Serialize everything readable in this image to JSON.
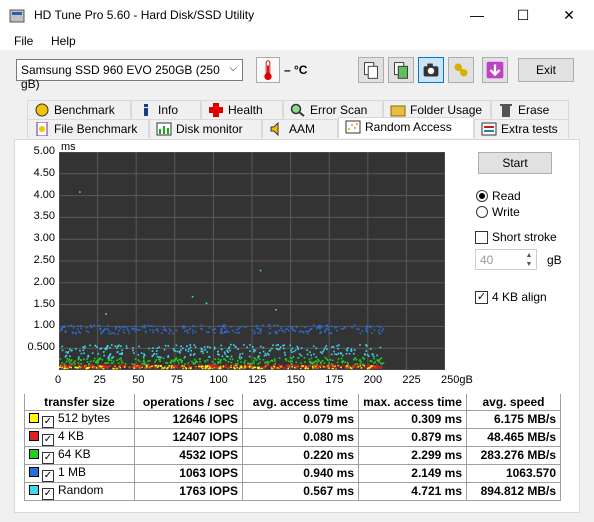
{
  "window": {
    "title": "HD Tune Pro 5.60 - Hard Disk/SSD Utility",
    "minimize": "—",
    "maximize": "☐",
    "close": "✕"
  },
  "menu": {
    "file": "File",
    "help": "Help"
  },
  "toolbar": {
    "drive": "Samsung SSD 960 EVO 250GB (250 gB)",
    "temperature": "– °C",
    "exit_label": "Exit"
  },
  "tabs": {
    "row1": [
      {
        "label": "Benchmark",
        "icon": "benchmark-icon"
      },
      {
        "label": "Info",
        "icon": "info-icon"
      },
      {
        "label": "Health",
        "icon": "health-icon"
      },
      {
        "label": "Error Scan",
        "icon": "error-scan-icon"
      },
      {
        "label": "Folder Usage",
        "icon": "folder-icon"
      },
      {
        "label": "Erase",
        "icon": "trash-icon"
      }
    ],
    "row2": [
      {
        "label": "File Benchmark",
        "icon": "file-benchmark-icon"
      },
      {
        "label": "Disk monitor",
        "icon": "disk-monitor-icon"
      },
      {
        "label": "AAM",
        "icon": "speaker-icon"
      },
      {
        "label": "Random Access",
        "icon": "random-access-icon"
      },
      {
        "label": "Extra tests",
        "icon": "extra-tests-icon"
      }
    ]
  },
  "controls": {
    "start": "Start",
    "read": "Read",
    "write": "Write",
    "short_stroke": "Short stroke",
    "stroke_value": "40",
    "stroke_unit": "gB",
    "align": "4 KB align",
    "mode_selected": "Read"
  },
  "chart_data": {
    "type": "scatter",
    "ylabel": "ms",
    "xlabel": "",
    "x_unit": "gB",
    "xlim": [
      0,
      250
    ],
    "ylim": [
      0,
      5
    ],
    "y_ticks": [
      "5.00",
      "4.50",
      "4.00",
      "3.50",
      "3.00",
      "2.50",
      "2.00",
      "1.50",
      "1.00",
      "0.500"
    ],
    "x_ticks": [
      "0",
      "25",
      "50",
      "75",
      "100",
      "125",
      "150",
      "175",
      "200",
      "225",
      "250gB"
    ],
    "grid": true,
    "series": [
      {
        "name": "512 bytes",
        "color": "#ffff00",
        "band": [
          0.05,
          0.12
        ]
      },
      {
        "name": "4 KB",
        "color": "#e02020",
        "band": [
          0.06,
          0.14
        ]
      },
      {
        "name": "64 KB",
        "color": "#20d020",
        "band": [
          0.15,
          0.3
        ]
      },
      {
        "name": "1 MB",
        "color": "#2a6ed8",
        "band": [
          0.85,
          1.05
        ]
      },
      {
        "name": "Random",
        "color": "#40d8f0",
        "band": [
          0.3,
          0.6
        ]
      }
    ]
  },
  "results": {
    "headers": [
      "transfer size",
      "operations / sec",
      "avg. access time",
      "max. access time",
      "avg. speed"
    ],
    "rows": [
      {
        "label": "512 bytes",
        "color": "#ffff00",
        "ops": "12646 IOPS",
        "avg": "0.079 ms",
        "max": "0.309 ms",
        "speed": "6.175 MB/s"
      },
      {
        "label": "4 KB",
        "color": "#e02020",
        "ops": "12407 IOPS",
        "avg": "0.080 ms",
        "max": "0.879 ms",
        "speed": "48.465 MB/s"
      },
      {
        "label": "64 KB",
        "color": "#20d020",
        "ops": "4532 IOPS",
        "avg": "0.220 ms",
        "max": "2.299 ms",
        "speed": "283.276 MB/s"
      },
      {
        "label": "1 MB",
        "color": "#2a6ed8",
        "ops": "1063 IOPS",
        "avg": "0.940 ms",
        "max": "2.149 ms",
        "speed": "1063.570"
      },
      {
        "label": "Random",
        "color": "#40d8f0",
        "ops": "1763 IOPS",
        "avg": "0.567 ms",
        "max": "4.721 ms",
        "speed": "894.812 MB/s"
      }
    ]
  }
}
